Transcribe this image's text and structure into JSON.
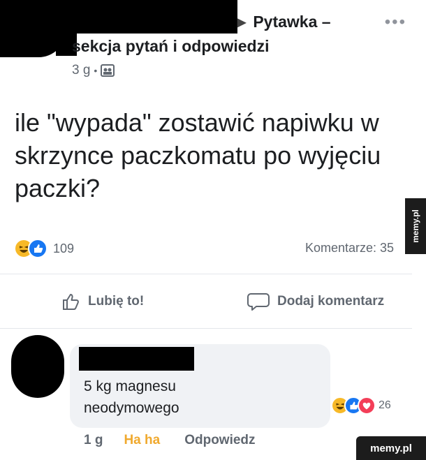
{
  "post": {
    "group_line1": "Pytawka –",
    "group_line2": "sekcja pytań i odpowiedzi",
    "time": "3 g",
    "more": "•••",
    "text": "ile \"wypada\" zostawić napiwku w skrzynce paczkomatu po wyjęciu paczki?",
    "reaction_count": "109",
    "comments_label": "Komentarze: 35",
    "like_label": "Lubię to!",
    "comment_label": "Dodaj komentarz"
  },
  "comment": {
    "text_line1": "5 kg magnesu",
    "text_line2": "neodymowego",
    "reaction_count": "26",
    "time": "1 g",
    "haha_label": "Ha ha",
    "reply_label": "Odpowiedz"
  },
  "watermark": {
    "vertical": "memy.pl",
    "corner": "memy.pl"
  },
  "colors": {
    "like_blue": "#1877f2",
    "haha_yellow": "#f7b928",
    "love_red": "#f33e58",
    "muted": "#606770"
  }
}
